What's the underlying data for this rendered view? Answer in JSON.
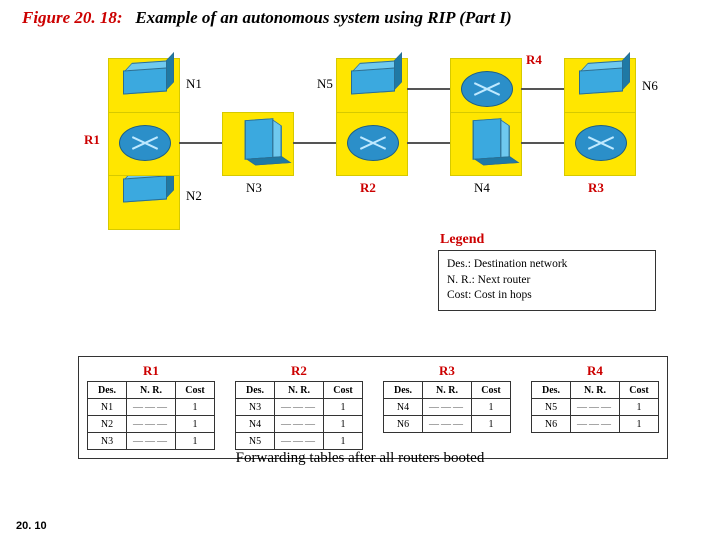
{
  "figure": {
    "number": "Figure 20. 18:",
    "title": "Example of an autonomous system using RIP (Part I)"
  },
  "networks": {
    "N1": "N1",
    "N2": "N2",
    "N3": "N3",
    "N4": "N4",
    "N5": "N5",
    "N6": "N6"
  },
  "routers": {
    "R1": "R1",
    "R2": "R2",
    "R3": "R3",
    "R4": "R4"
  },
  "legend": {
    "title": "Legend",
    "l1": "Des.: Destination network",
    "l2": "N. R.: Next router",
    "l3": "Cost: Cost in hops"
  },
  "table_headers": {
    "des": "Des.",
    "nr": "N. R.",
    "cost": "Cost"
  },
  "tables": {
    "R1": {
      "name": "R1",
      "rows": [
        {
          "des": "N1",
          "cost": "1"
        },
        {
          "des": "N2",
          "cost": "1"
        },
        {
          "des": "N3",
          "cost": "1"
        }
      ]
    },
    "R2": {
      "name": "R2",
      "rows": [
        {
          "des": "N3",
          "cost": "1"
        },
        {
          "des": "N4",
          "cost": "1"
        },
        {
          "des": "N5",
          "cost": "1"
        }
      ]
    },
    "R3": {
      "name": "R3",
      "rows": [
        {
          "des": "N4",
          "cost": "1"
        },
        {
          "des": "N6",
          "cost": "1"
        }
      ]
    },
    "R4": {
      "name": "R4",
      "rows": [
        {
          "des": "N5",
          "cost": "1"
        },
        {
          "des": "N6",
          "cost": "1"
        }
      ]
    }
  },
  "caption": "Forwarding tables after all routers booted",
  "pagenum": "20. 10",
  "dash": "———"
}
